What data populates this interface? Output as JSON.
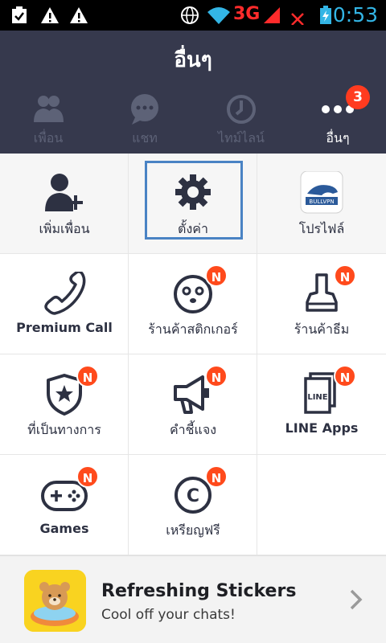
{
  "status_bar": {
    "network": "3G",
    "clock": "0:53"
  },
  "header": {
    "title": "อื่นๆ",
    "tabs": [
      {
        "label": "เพื่อน",
        "icon": "friends-icon"
      },
      {
        "label": "แชท",
        "icon": "chat-icon"
      },
      {
        "label": "ไทม์ไลน์",
        "icon": "clock-icon"
      },
      {
        "label": "อื่นๆ",
        "icon": "more-icon",
        "badge": "3",
        "active": true
      }
    ]
  },
  "grid": {
    "items": [
      {
        "label": "เพิ่มเพื่อน",
        "icon": "add-friend-icon"
      },
      {
        "label": "ตั้งค่า",
        "icon": "gear-icon"
      },
      {
        "label": "โปรไฟล์",
        "icon": "profile-avatar-icon",
        "avatar_text": "BULLVPN"
      },
      {
        "label": "Premium Call",
        "icon": "phone-icon"
      },
      {
        "label": "ร้านค้าสติกเกอร์",
        "icon": "sticker-face-icon",
        "badge": "N"
      },
      {
        "label": "ร้านค้าธีม",
        "icon": "paint-brush-icon",
        "badge": "N"
      },
      {
        "label": "ที่เป็นทางการ",
        "icon": "official-shield-icon",
        "badge": "N"
      },
      {
        "label": "คำชี้แจง",
        "icon": "megaphone-icon",
        "badge": "N"
      },
      {
        "label": "LINE Apps",
        "icon": "line-apps-icon",
        "badge": "N",
        "icon_text": "LINE"
      },
      {
        "label": "Games",
        "icon": "gamepad-icon",
        "badge": "N"
      },
      {
        "label": "เหรียญฟรี",
        "icon": "coin-icon",
        "badge": "N",
        "icon_text": "C"
      }
    ]
  },
  "banner": {
    "title": "Refreshing Stickers",
    "subtitle": "Cool off your chats!"
  },
  "colors": {
    "header_bg": "#36394d",
    "badge_bg": "#ff4a1c",
    "highlight": "#4a83c4",
    "icon": "#2d3142",
    "clock": "#33b5e5"
  }
}
